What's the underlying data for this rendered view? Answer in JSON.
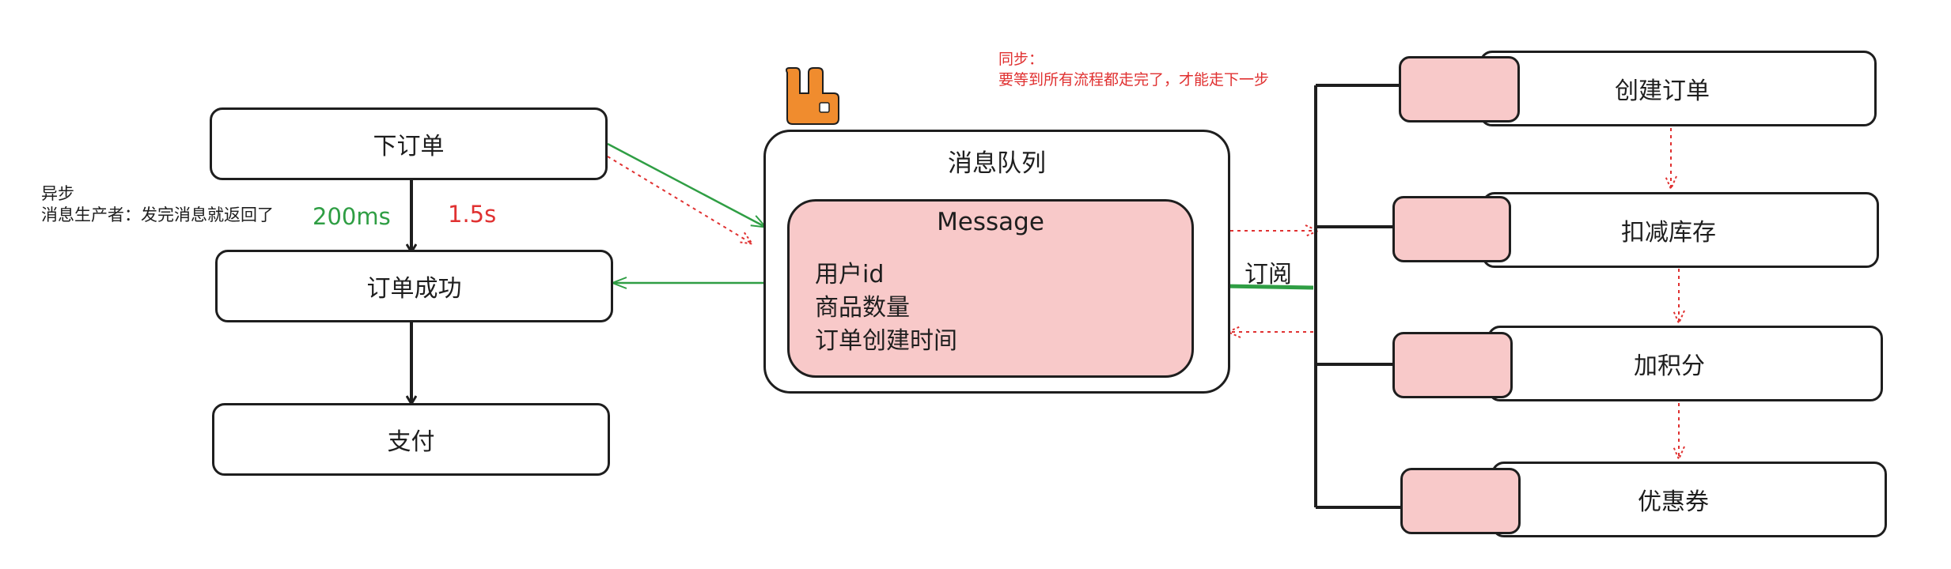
{
  "left_flow": {
    "place_order": "下订单",
    "order_success": "订单成功",
    "pay": "支付",
    "async_title": "异步",
    "async_desc": "消息生产者：发完消息就返回了",
    "time_fast": "200ms",
    "time_slow": "1.5s"
  },
  "queue": {
    "icon": "rabbitmq-icon",
    "title": "消息队列",
    "message_title": "Message",
    "fields": [
      "用户id",
      "商品数量",
      "订单创建时间"
    ]
  },
  "subscribe_label": "订阅",
  "sync_note": {
    "title": "同步：",
    "desc": "要等到所有流程都走完了，才能走下一步"
  },
  "right_steps": [
    "创建订单",
    "扣减库存",
    "加积分",
    "优惠券"
  ],
  "colors": {
    "pink": "#f8c9c9",
    "green": "#2f9e44",
    "red": "#e03131",
    "orange": "#f08c2e",
    "stroke": "#1e1e1e"
  }
}
